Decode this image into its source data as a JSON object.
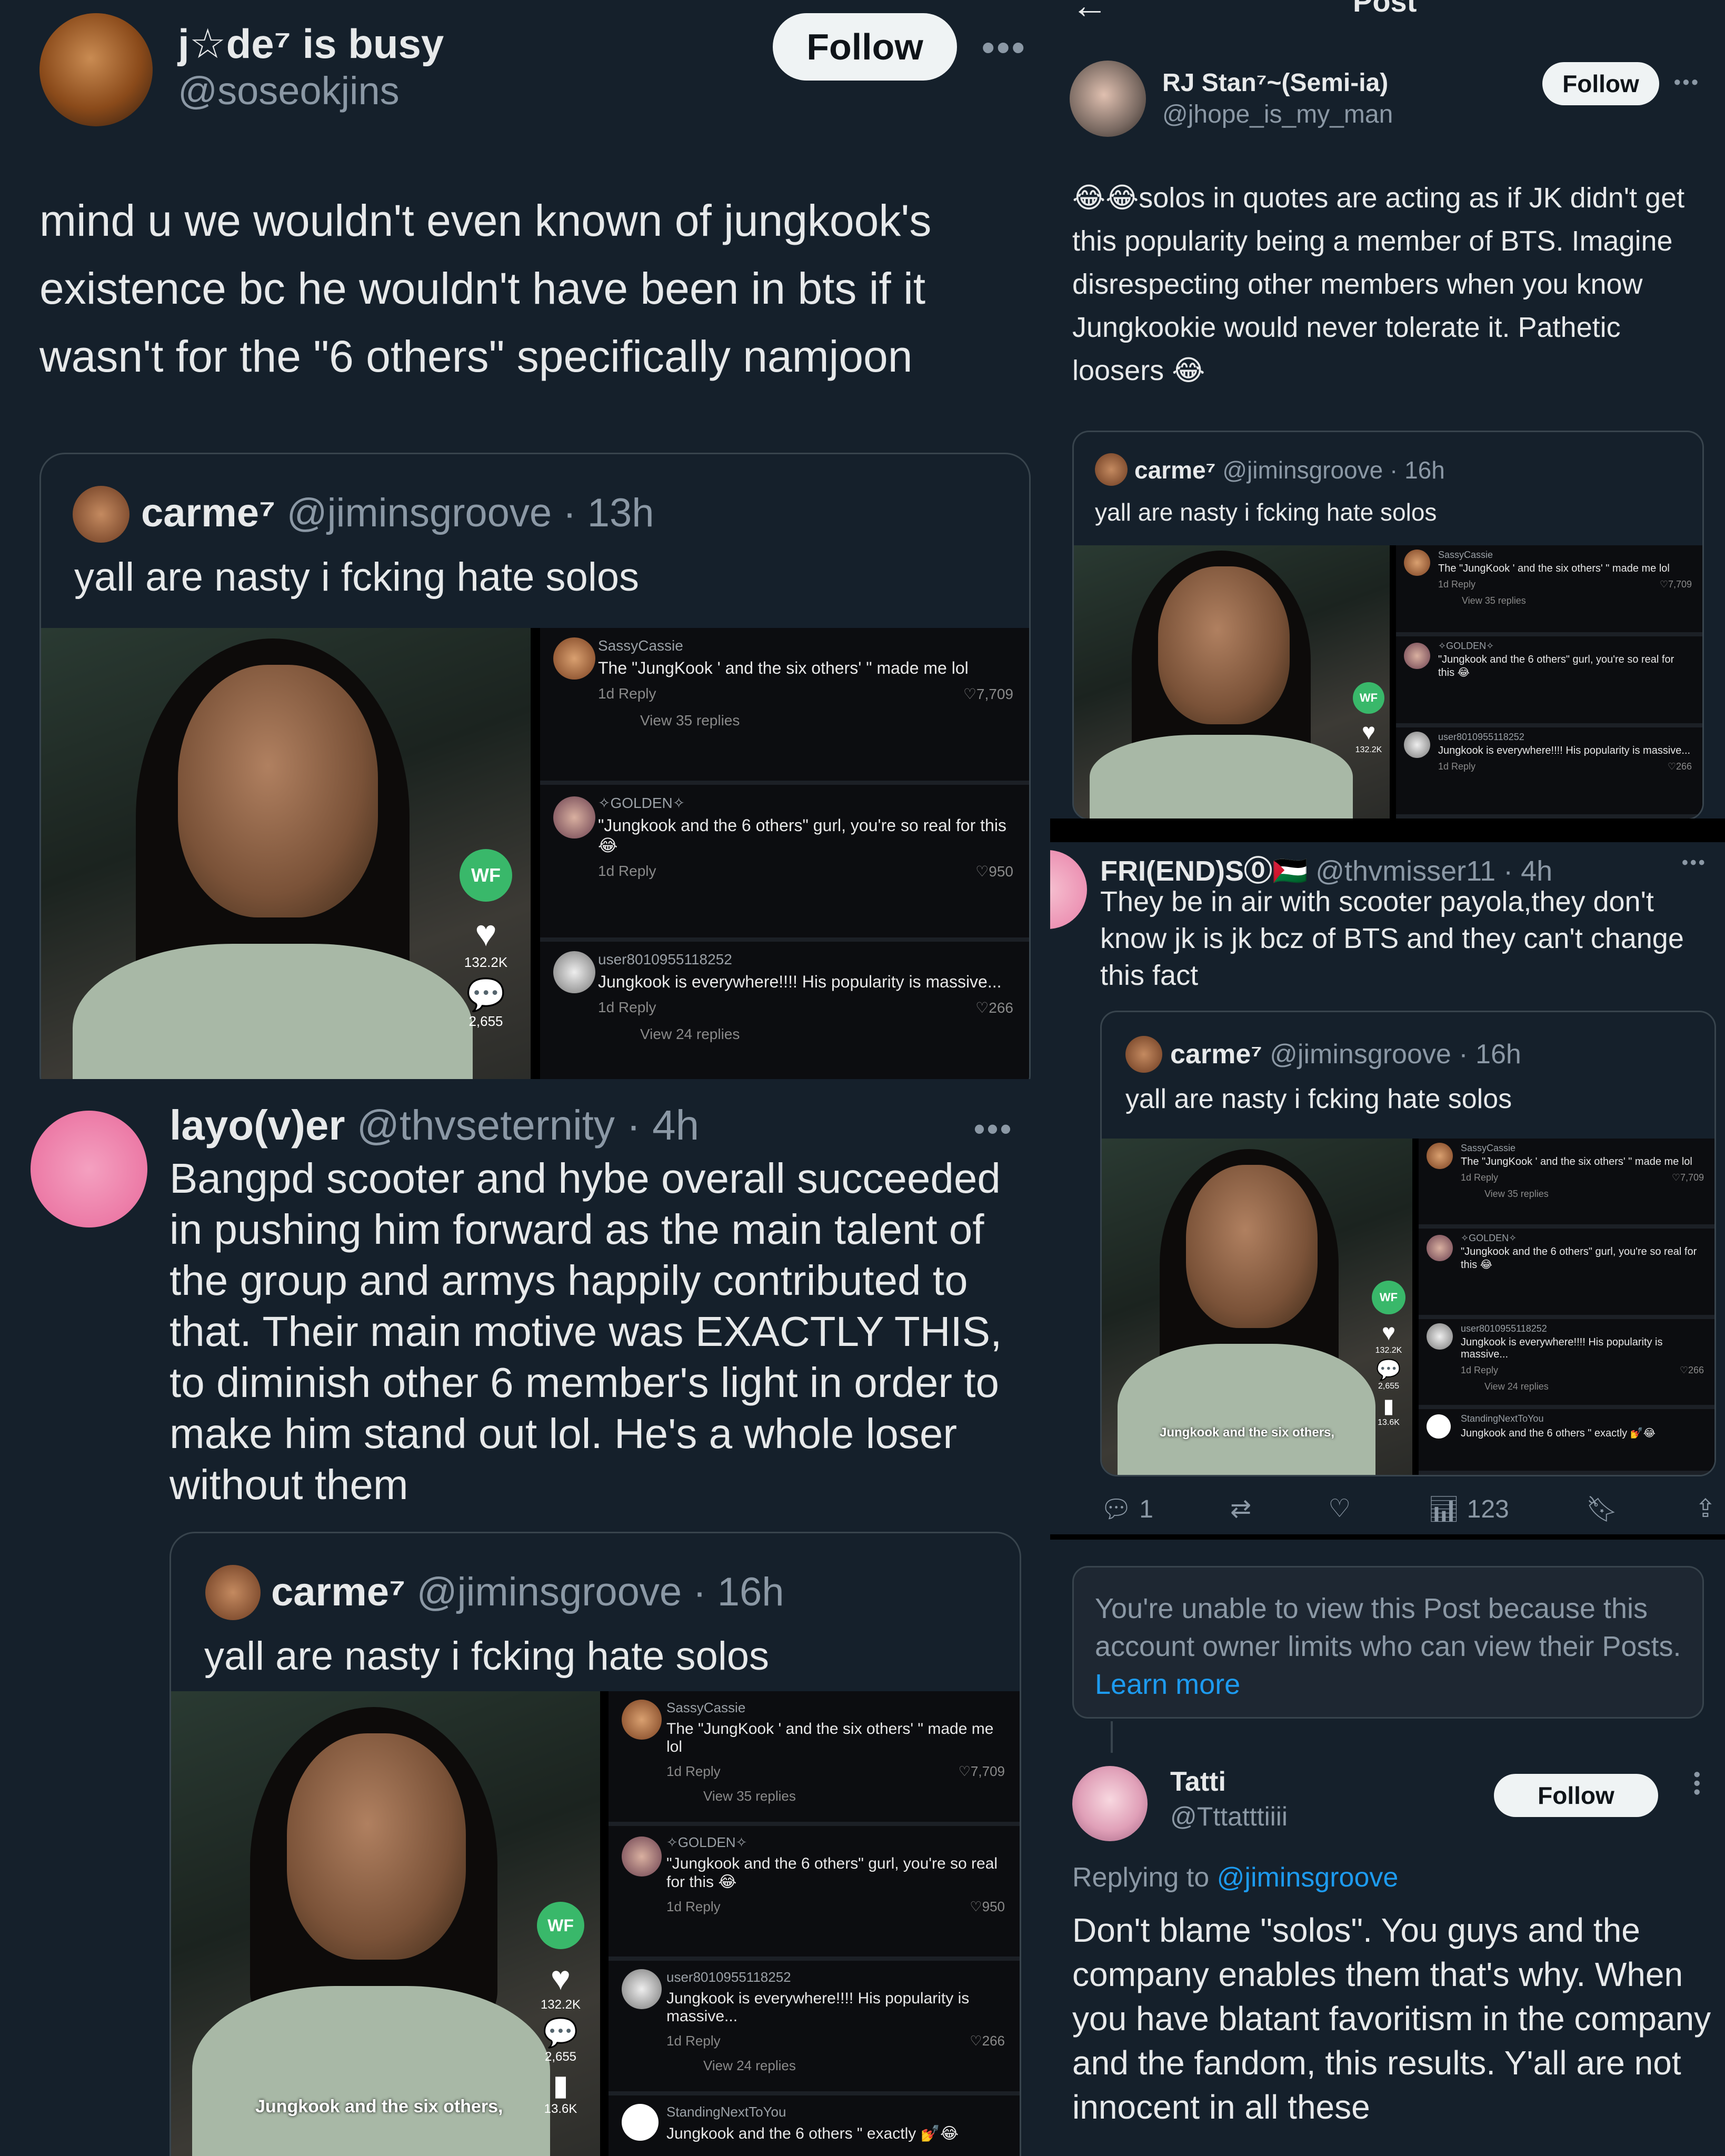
{
  "colors": {
    "bg": "#15202b",
    "text": "#e7e9ea",
    "muted": "#8b98a5",
    "link": "#1d9bf0",
    "border": "#38444d"
  },
  "tl": {
    "name": "j☆de⁷ is busy",
    "handle": "@soseokjins",
    "follow": "Follow",
    "text": "mind u we wouldn't even known of jungkook's existence bc he wouldn't have been in bts if it wasn't for the \"6 others\" specifically namjoon",
    "quote": {
      "name": "carme⁷",
      "handle": "@jiminsgroove · 13h",
      "text": "yall are nasty i fcking hate solos"
    }
  },
  "ml": {
    "name": "layo(v)er",
    "handle": "@thvseternity · 4h",
    "text": "Bangpd scooter and hybe overall succeeded in pushing him forward as the main talent of the group and armys happily contributed to that. Their main motive was EXACTLY THIS, to diminish other 6 member's light in order to make him stand out lol. He's a whole loser without them",
    "quote": {
      "name": "carme⁷",
      "handle": "@jiminsgroove · 16h",
      "text": "yall are nasty i fcking hate solos"
    }
  },
  "tr": {
    "header": "Post",
    "name": "RJ Stan⁷~(Semi-ia)",
    "handle": "@jhope_is_my_man",
    "follow": "Follow",
    "text": "😂😂solos in quotes are acting as if JK didn't get this popularity being a member of BTS. Imagine disrespecting other members when you know Jungkookie would never tolerate it. Pathetic loosers 😂",
    "quote": {
      "name": "carme⁷",
      "handle": "@jiminsgroove · 16h",
      "text": "yall are nasty i fcking hate solos"
    }
  },
  "mr": {
    "name": "FRI(END)S⓪🇵🇸",
    "handle": "@thvmisser11 · 4h",
    "text": "They be in air with scooter payola,they don't know jk is jk bcz of BTS and they can't change this fact",
    "quote": {
      "name": "carme⁷",
      "handle": "@jiminsgroove · 16h",
      "text": "yall are nasty i fcking hate solos"
    },
    "actions": {
      "replies": "1",
      "views": "123"
    }
  },
  "notice": {
    "text": "You're unable to view this Post because this account owner limits who can view their Posts.",
    "link": "Learn more"
  },
  "br": {
    "name": "Tatti",
    "handle": "@Tttatttiiii",
    "follow": "Follow",
    "replying": "Replying to",
    "replying_to": "@jiminsgroove",
    "text": "Don't blame \"solos\". You guys and the company enables them that's why. When you have blatant favoritism in the company and the fandom, this results. Y'all are not innocent in all these"
  },
  "tiktok": {
    "c1_user": "SassyCassie",
    "c1_text": "The \"JungKook ' and the six others' \" made me lol",
    "c1_meta": "1d   Reply",
    "c1_likes": "♡7,709",
    "c1_more": "View 35 replies",
    "c2_user": "✧GOLDEN✧",
    "c2_text": "\"Jungkook and the 6 others\" gurl, you're so real for this 😂",
    "c2_meta": "1d   Reply",
    "c2_likes": "♡950",
    "c3_user": "user8010955118252",
    "c3_text": "Jungkook is everywhere!!!! His popularity is massive...",
    "c3_meta": "1d   Reply",
    "c3_likes": "♡266",
    "c3_more": "View 24 replies",
    "c4_user": "StandingNextToYou",
    "c4_text": "Jungkook and the 6 others \" exactly 💅😂",
    "likes": "132.2K",
    "comments": "2,655",
    "saves": "13.6K",
    "caption": "Jungkook and the six others,"
  }
}
